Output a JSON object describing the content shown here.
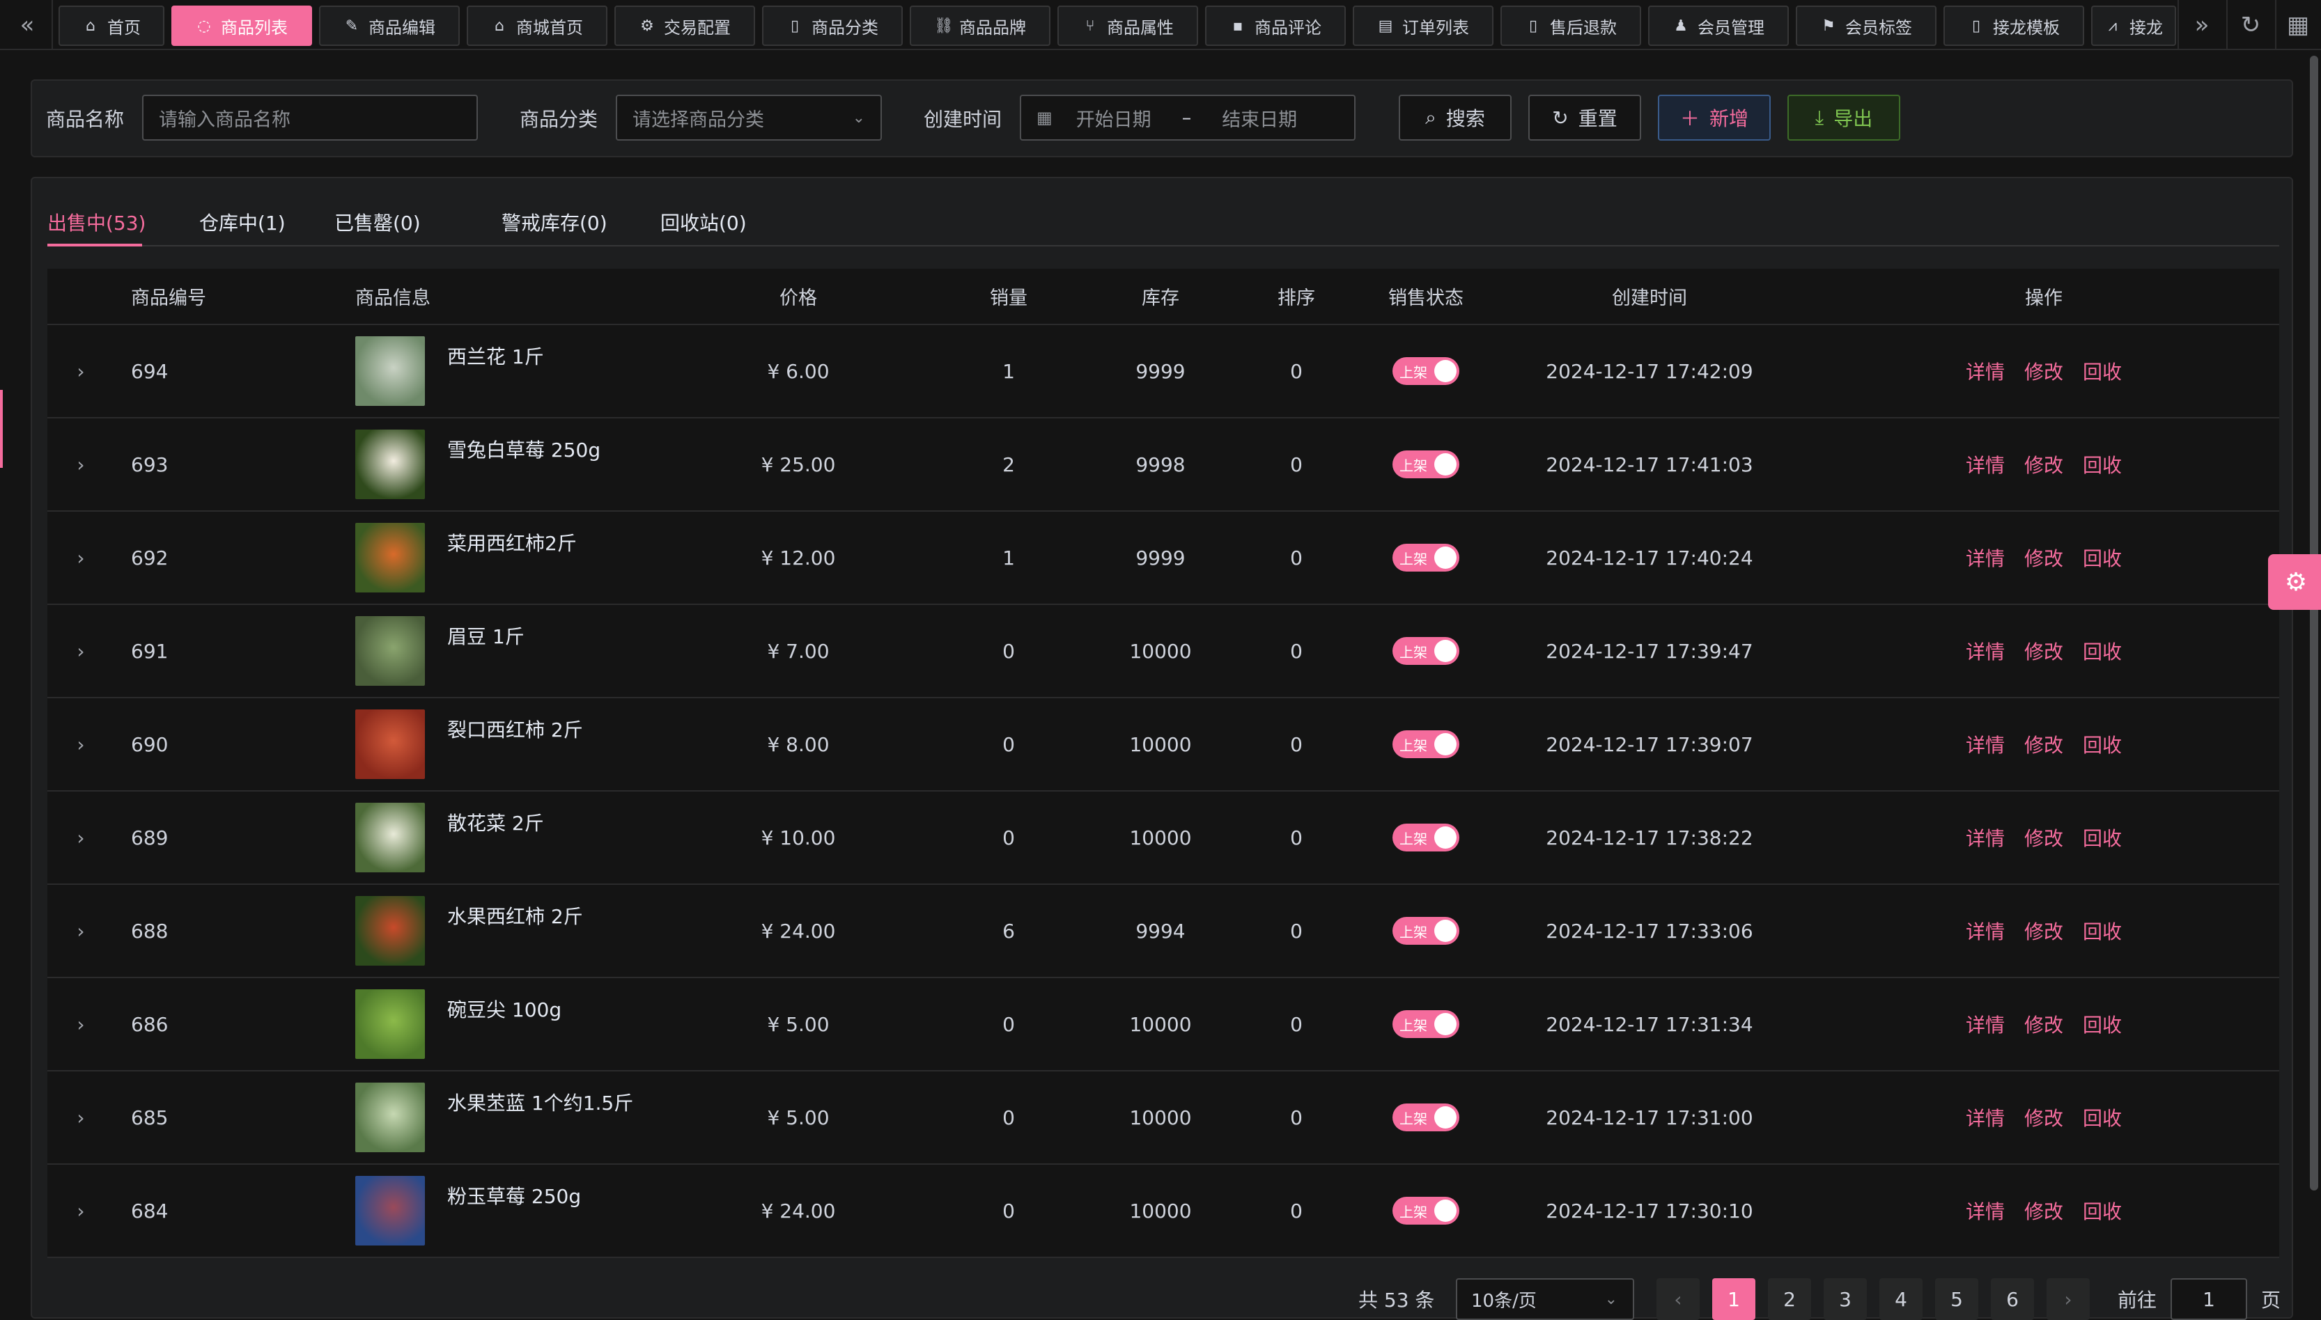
{
  "tabs_bar": {
    "tabs": [
      {
        "label": "首页",
        "icon": "home-icon",
        "glyph": "⌂",
        "active": false
      },
      {
        "label": "商品列表",
        "icon": "box-icon",
        "glyph": "◌",
        "active": true
      },
      {
        "label": "商品编辑",
        "icon": "edit-icon",
        "glyph": "✎",
        "active": false
      },
      {
        "label": "商城首页",
        "icon": "home-icon",
        "glyph": "⌂",
        "active": false
      },
      {
        "label": "交易配置",
        "icon": "gear-icon",
        "glyph": "⚙",
        "active": false
      },
      {
        "label": "商品分类",
        "icon": "document-icon",
        "glyph": "▯",
        "active": false
      },
      {
        "label": "商品品牌",
        "icon": "link-icon",
        "glyph": "⛓",
        "active": false
      },
      {
        "label": "商品属性",
        "icon": "branch-icon",
        "glyph": "⑂",
        "active": false
      },
      {
        "label": "商品评论",
        "icon": "comment-icon",
        "glyph": "▪",
        "active": false
      },
      {
        "label": "订单列表",
        "icon": "list-icon",
        "glyph": "▤",
        "active": false
      },
      {
        "label": "售后退款",
        "icon": "receipt-icon",
        "glyph": "▯",
        "active": false
      },
      {
        "label": "会员管理",
        "icon": "user-icon",
        "glyph": "♟",
        "active": false
      },
      {
        "label": "会员标签",
        "icon": "bookmark-icon",
        "glyph": "⚑",
        "active": false
      },
      {
        "label": "接龙模板",
        "icon": "file-icon",
        "glyph": "▯",
        "active": false
      },
      {
        "label": "接龙",
        "icon": "chart-icon",
        "glyph": "⩘",
        "active": false
      }
    ]
  },
  "search": {
    "name_label": "商品名称",
    "name_placeholder": "请输入商品名称",
    "category_label": "商品分类",
    "category_placeholder": "请选择商品分类",
    "time_label": "创建时间",
    "start_placeholder": "开始日期",
    "range_sep": "–",
    "end_placeholder": "结束日期",
    "search_btn": "搜索",
    "reset_btn": "重置",
    "add_btn": "新增",
    "export_btn": "导出"
  },
  "status_tabs": [
    {
      "label": "出售中(53)",
      "active": true
    },
    {
      "label": "仓库中(1)",
      "active": false
    },
    {
      "label": "已售罄(0)",
      "active": false
    },
    {
      "label": "警戒库存(0)",
      "active": false
    },
    {
      "label": "回收站(0)",
      "active": false
    }
  ],
  "table": {
    "headers": {
      "id": "商品编号",
      "info": "商品信息",
      "price": "价格",
      "sales": "销量",
      "stock": "库存",
      "sort": "排序",
      "status": "销售状态",
      "created": "创建时间",
      "ops": "操作"
    },
    "switch_label": "上架",
    "ops": {
      "detail": "详情",
      "edit": "修改",
      "recycle": "回收"
    },
    "rows": [
      {
        "id": "694",
        "name": "西兰花 1斤",
        "price": "¥ 6.00",
        "sales": "1",
        "stock": "9999",
        "sort": "0",
        "created": "2024-12-17 17:42:09",
        "thumb_colors": [
          "#6f8a6a",
          "#c9d2c4"
        ]
      },
      {
        "id": "693",
        "name": "雪兔白草莓 250g",
        "price": "¥ 25.00",
        "sales": "2",
        "stock": "9998",
        "sort": "0",
        "created": "2024-12-17 17:41:03",
        "thumb_colors": [
          "#2f4a1c",
          "#f2ede0"
        ]
      },
      {
        "id": "692",
        "name": "菜用西红柿2斤",
        "price": "¥ 12.00",
        "sales": "1",
        "stock": "9999",
        "sort": "0",
        "created": "2024-12-17 17:40:24",
        "thumb_colors": [
          "#3c5a22",
          "#d96a2a"
        ]
      },
      {
        "id": "691",
        "name": "眉豆 1斤",
        "price": "¥ 7.00",
        "sales": "0",
        "stock": "10000",
        "sort": "0",
        "created": "2024-12-17 17:39:47",
        "thumb_colors": [
          "#4a5e3a",
          "#8aa46e"
        ]
      },
      {
        "id": "690",
        "name": "裂口西红柿 2斤",
        "price": "¥ 8.00",
        "sales": "0",
        "stock": "10000",
        "sort": "0",
        "created": "2024-12-17 17:39:07",
        "thumb_colors": [
          "#8c2a1c",
          "#d25a3a"
        ]
      },
      {
        "id": "689",
        "name": "散花菜 2斤",
        "price": "¥ 10.00",
        "sales": "0",
        "stock": "10000",
        "sort": "0",
        "created": "2024-12-17 17:38:22",
        "thumb_colors": [
          "#4d6a38",
          "#e8ead8"
        ]
      },
      {
        "id": "688",
        "name": "水果西红柿 2斤",
        "price": "¥ 24.00",
        "sales": "6",
        "stock": "9994",
        "sort": "0",
        "created": "2024-12-17 17:33:06",
        "thumb_colors": [
          "#2c4a1c",
          "#c84a2a"
        ]
      },
      {
        "id": "686",
        "name": "碗豆尖 100g",
        "price": "¥ 5.00",
        "sales": "0",
        "stock": "10000",
        "sort": "0",
        "created": "2024-12-17 17:31:34",
        "thumb_colors": [
          "#4e7a2a",
          "#8cba4a"
        ]
      },
      {
        "id": "685",
        "name": "水果苤蓝 1个约1.5斤",
        "price": "¥ 5.00",
        "sales": "0",
        "stock": "10000",
        "sort": "0",
        "created": "2024-12-17 17:31:00",
        "thumb_colors": [
          "#5a7a4a",
          "#c6d8b2"
        ]
      },
      {
        "id": "684",
        "name": "粉玉草莓 250g",
        "price": "¥ 24.00",
        "sales": "0",
        "stock": "10000",
        "sort": "0",
        "created": "2024-12-17 17:30:10",
        "thumb_colors": [
          "#2a4a8a",
          "#9a4a5a"
        ]
      }
    ]
  },
  "pagination": {
    "total_text": "共 53 条",
    "page_size": "10条/页",
    "pages": [
      "1",
      "2",
      "3",
      "4",
      "5",
      "6"
    ],
    "current": "1",
    "goto_label": "前往",
    "goto_value": "1",
    "page_suffix": "页"
  },
  "colors": {
    "accent": "#f56c9d",
    "success": "#7ec450",
    "background": "#141414",
    "panel": "#1d1e1f"
  }
}
